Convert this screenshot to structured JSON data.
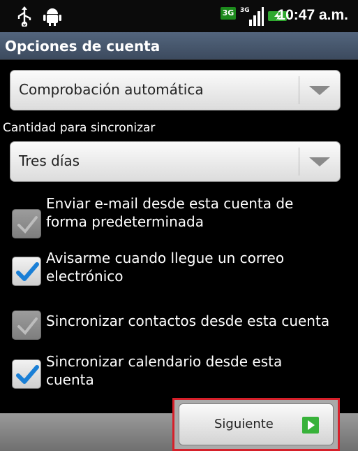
{
  "status_bar": {
    "time": "10:47 a.m.",
    "network": "3G",
    "icons": [
      "usb-icon",
      "android-icon",
      "3g-icon",
      "signal-icon",
      "battery-charging-icon"
    ]
  },
  "title": "Opciones de cuenta",
  "check_frequency": {
    "selected": "Comprobación automática"
  },
  "sync_amount": {
    "label": "Cantidad para sincronizar",
    "selected": "Tres días"
  },
  "options": [
    {
      "label_line1": "Enviar e-mail desde esta cuenta de",
      "label_line2": "forma predeterminada",
      "checked": false,
      "enabled": false
    },
    {
      "label_line1": "Avisarme cuando llegue un correo",
      "label_line2": "electrónico",
      "checked": true,
      "enabled": true
    },
    {
      "label_line1": "Sincronizar contactos desde esta cuenta",
      "label_line2": "",
      "checked": false,
      "enabled": false
    },
    {
      "label_line1": "Sincronizar calendario desde esta",
      "label_line2": "cuenta",
      "checked": true,
      "enabled": true
    }
  ],
  "footer": {
    "next_label": "Siguiente"
  },
  "colors": {
    "highlight": "#d6202a",
    "check": "#1a7fd6",
    "next_icon": "#38b23a"
  }
}
